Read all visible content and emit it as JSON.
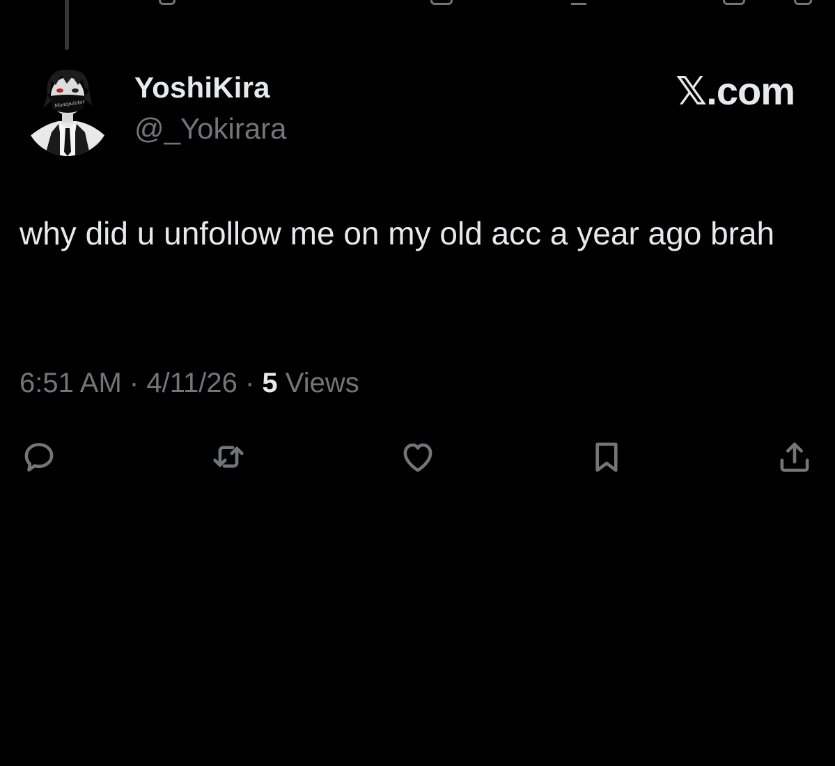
{
  "tweet": {
    "author": {
      "display_name": "YoshiKira",
      "handle": "@_Yokirara",
      "avatar_mask_text": "Manipulator"
    },
    "brand": "𝕏.com",
    "text": "why did u unfollow me on my old acc a year ago brah",
    "meta": {
      "time": "6:51 AM",
      "separator_1": "·",
      "date": "4/11/26",
      "separator_2": "·",
      "views_count": "5",
      "views_label": "Views"
    }
  },
  "actions": [
    {
      "name": "reply",
      "icon": "speech-bubble-icon"
    },
    {
      "name": "repost",
      "icon": "repost-arrows-icon"
    },
    {
      "name": "like",
      "icon": "heart-icon"
    },
    {
      "name": "bookmark",
      "icon": "bookmark-icon"
    },
    {
      "name": "share",
      "icon": "share-upload-icon"
    }
  ],
  "colors": {
    "background": "#000000",
    "primary_text": "#e7e9ea",
    "secondary_text": "#71767b",
    "thread_line": "#333639"
  }
}
